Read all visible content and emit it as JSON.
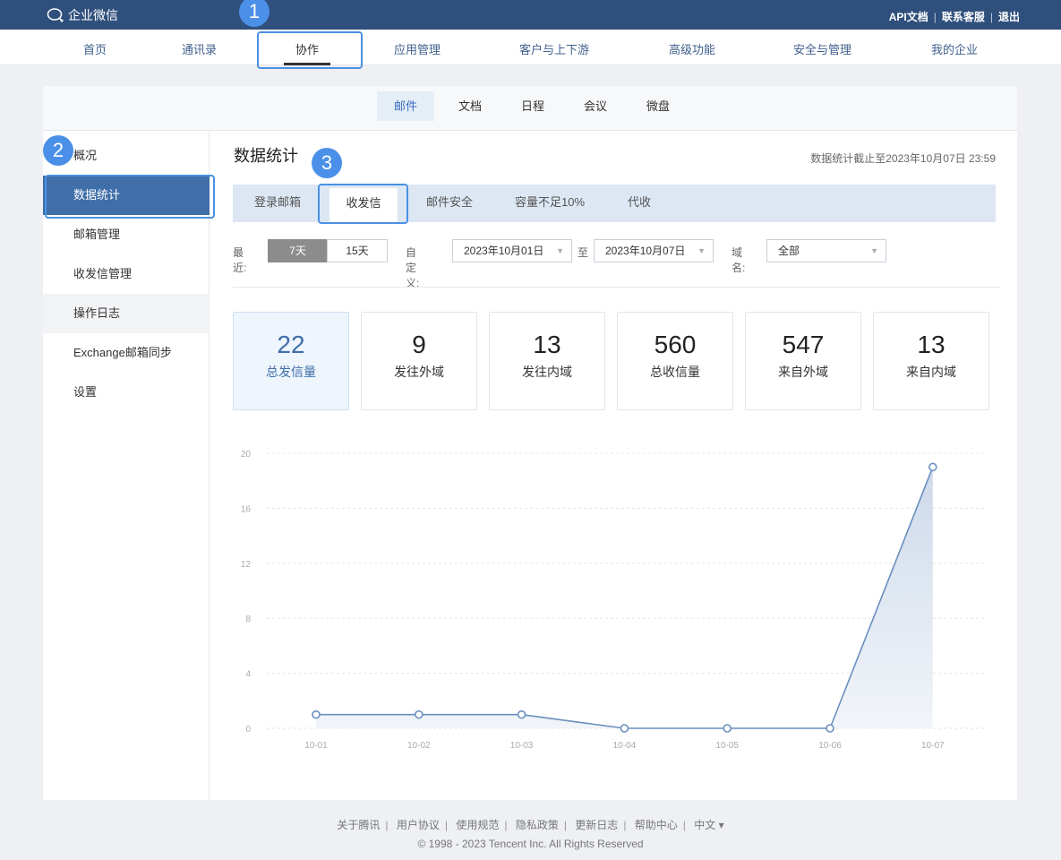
{
  "app": {
    "logo_text": "企业微信",
    "top_links": [
      "API文档",
      "联系客服",
      "退出"
    ]
  },
  "main_nav": [
    "首页",
    "通讯录",
    "协作",
    "应用管理",
    "客户与上下游",
    "高级功能",
    "安全与管理",
    "我的企业"
  ],
  "sub_nav": [
    "邮件",
    "文档",
    "日程",
    "会议",
    "微盘"
  ],
  "sidebar": [
    "概况",
    "数据统计",
    "邮箱管理",
    "收发信管理",
    "操作日志",
    "Exchange邮箱同步",
    "设置"
  ],
  "page": {
    "title": "数据统计",
    "date_note": "数据统计截止至2023年10月07日 23:59"
  },
  "tabs": [
    "登录邮箱",
    "收发信",
    "邮件安全",
    "容量不足10%",
    "代收"
  ],
  "filters": {
    "recent_label": "最近:",
    "seg_7": "7天",
    "seg_15": "15天",
    "custom_label": "自定义:",
    "start_date": "2023年10月01日",
    "to_label": "至",
    "end_date": "2023年10月07日",
    "domain_label": "域名:",
    "domain_value": "全部"
  },
  "stats": [
    {
      "value": "22",
      "label": "总发信量"
    },
    {
      "value": "9",
      "label": "发往外域"
    },
    {
      "value": "13",
      "label": "发往内域"
    },
    {
      "value": "560",
      "label": "总收信量"
    },
    {
      "value": "547",
      "label": "来自外域"
    },
    {
      "value": "13",
      "label": "来自内域"
    }
  ],
  "annotations": [
    "1",
    "2",
    "3"
  ],
  "chart_data": {
    "type": "area",
    "x": [
      "10-01",
      "10-02",
      "10-03",
      "10-04",
      "10-05",
      "10-06",
      "10-07"
    ],
    "series": [
      {
        "values": [
          1,
          1,
          1,
          0,
          0,
          0,
          19
        ]
      }
    ],
    "yticks": [
      0,
      4,
      8,
      12,
      16,
      20
    ],
    "ylim": [
      0,
      20
    ],
    "grid": true
  },
  "footer": {
    "links": [
      "关于腾讯",
      "用户协议",
      "使用规范",
      "隐私政策",
      "更新日志",
      "帮助中心",
      "中文 ▾"
    ],
    "copyright": "© 1998 - 2023 Tencent Inc. All Rights Reserved"
  },
  "colors": {
    "topbar": "#2f4f7c",
    "accent": "#3f6ea8",
    "annotation": "#4b90e8",
    "line": "#6a8fbf"
  }
}
